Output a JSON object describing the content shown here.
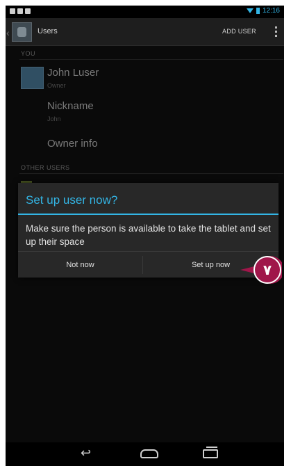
{
  "action_bar": {
    "title": "Users",
    "add_user_label": "ADD USER"
  },
  "sections": {
    "you_header": "YOU",
    "other_users_header": "OTHER USERS"
  },
  "owner": {
    "name": "John Luser",
    "role": "Owner"
  },
  "nickname": {
    "label": "Nickname",
    "value": "John"
  },
  "owner_info_label": "Owner info",
  "dialog": {
    "title": "Set up user now?",
    "message": "Make sure the person is available to take the tablet and set up their space",
    "negative_label": "Not now",
    "positive_label": "Set up now"
  },
  "callout_step": "٧",
  "colors": {
    "accent": "#33b5e5",
    "callout": "#a0164a"
  },
  "icons": {
    "nav_back": "back-arrow-icon",
    "nav_home": "home-icon",
    "nav_recent": "recent-apps-icon",
    "overflow": "overflow-menu-icon"
  }
}
